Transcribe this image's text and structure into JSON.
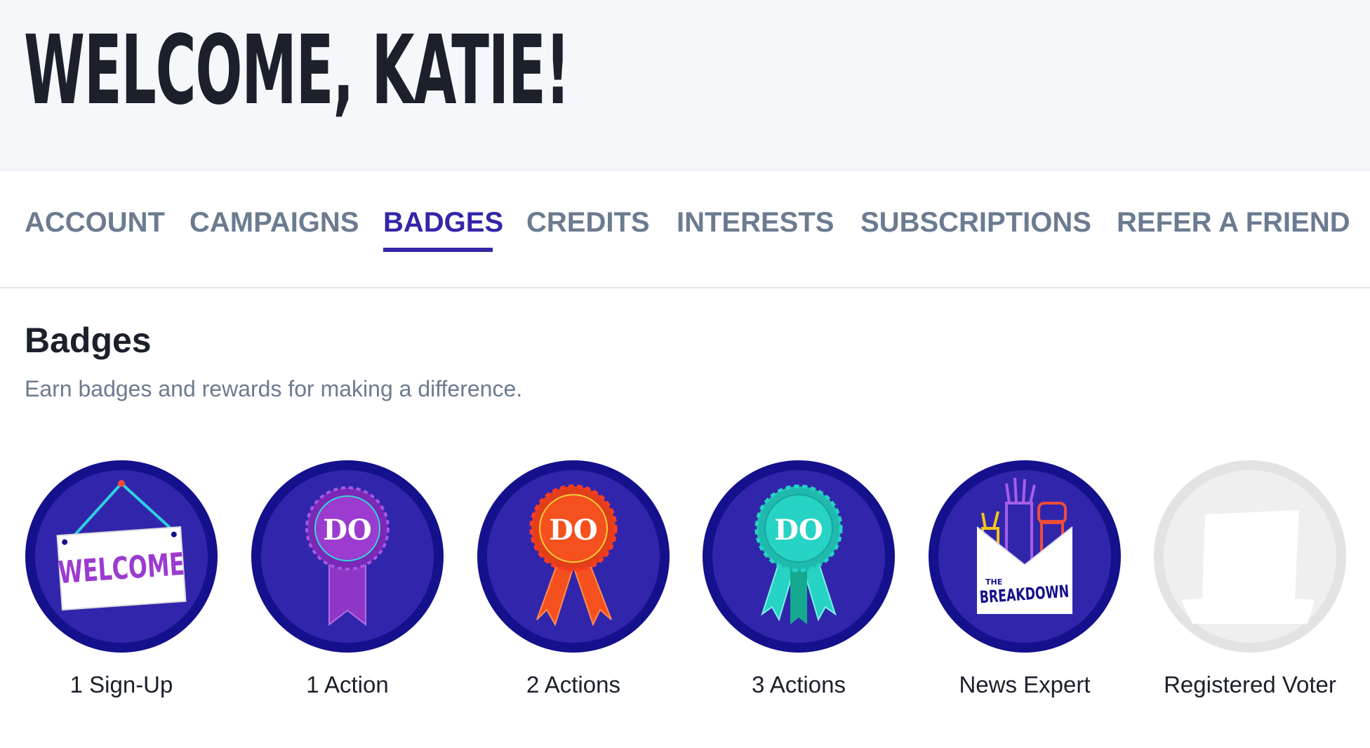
{
  "header": {
    "title": "WELCOME, KATIE!"
  },
  "tabs": [
    {
      "label": "ACCOUNT",
      "active": false
    },
    {
      "label": "CAMPAIGNS",
      "active": false
    },
    {
      "label": "BADGES",
      "active": true
    },
    {
      "label": "CREDITS",
      "active": false
    },
    {
      "label": "INTERESTS",
      "active": false
    },
    {
      "label": "SUBSCRIPTIONS",
      "active": false
    },
    {
      "label": "REFER A FRIEND",
      "active": false
    }
  ],
  "badges_section": {
    "title": "Badges",
    "subtitle": "Earn badges and rewards for making a difference.",
    "items": [
      {
        "label": "1 Sign-Up",
        "icon": "welcome-sign-icon",
        "sign_text": "WELCOME",
        "earned": true
      },
      {
        "label": "1 Action",
        "icon": "purple-ribbon-icon",
        "ribbon_text": "DO",
        "earned": true
      },
      {
        "label": "2 Actions",
        "icon": "orange-ribbon-icon",
        "ribbon_text": "DO",
        "earned": true
      },
      {
        "label": "3 Actions",
        "icon": "teal-ribbon-icon",
        "ribbon_text": "DO",
        "earned": true
      },
      {
        "label": "News Expert",
        "icon": "breakdown-envelope-icon",
        "small_text": "THE",
        "big_text": "BREAKDOWN",
        "earned": true
      },
      {
        "label": "Registered Voter",
        "icon": "locked-badge-icon",
        "earned": false
      }
    ]
  },
  "colors": {
    "accent": "#3326a8",
    "badge_outer": "#15108c",
    "badge_inner": "#3126ab",
    "tab_text": "#6c7b90",
    "heading_text": "#1b202b",
    "header_bg": "#f5f8fb",
    "purple_ribbon": "#8f36c7",
    "orange_ribbon": "#f4511e",
    "teal_ribbon": "#26d3c5",
    "locked_badge": "#e3e3e3"
  }
}
